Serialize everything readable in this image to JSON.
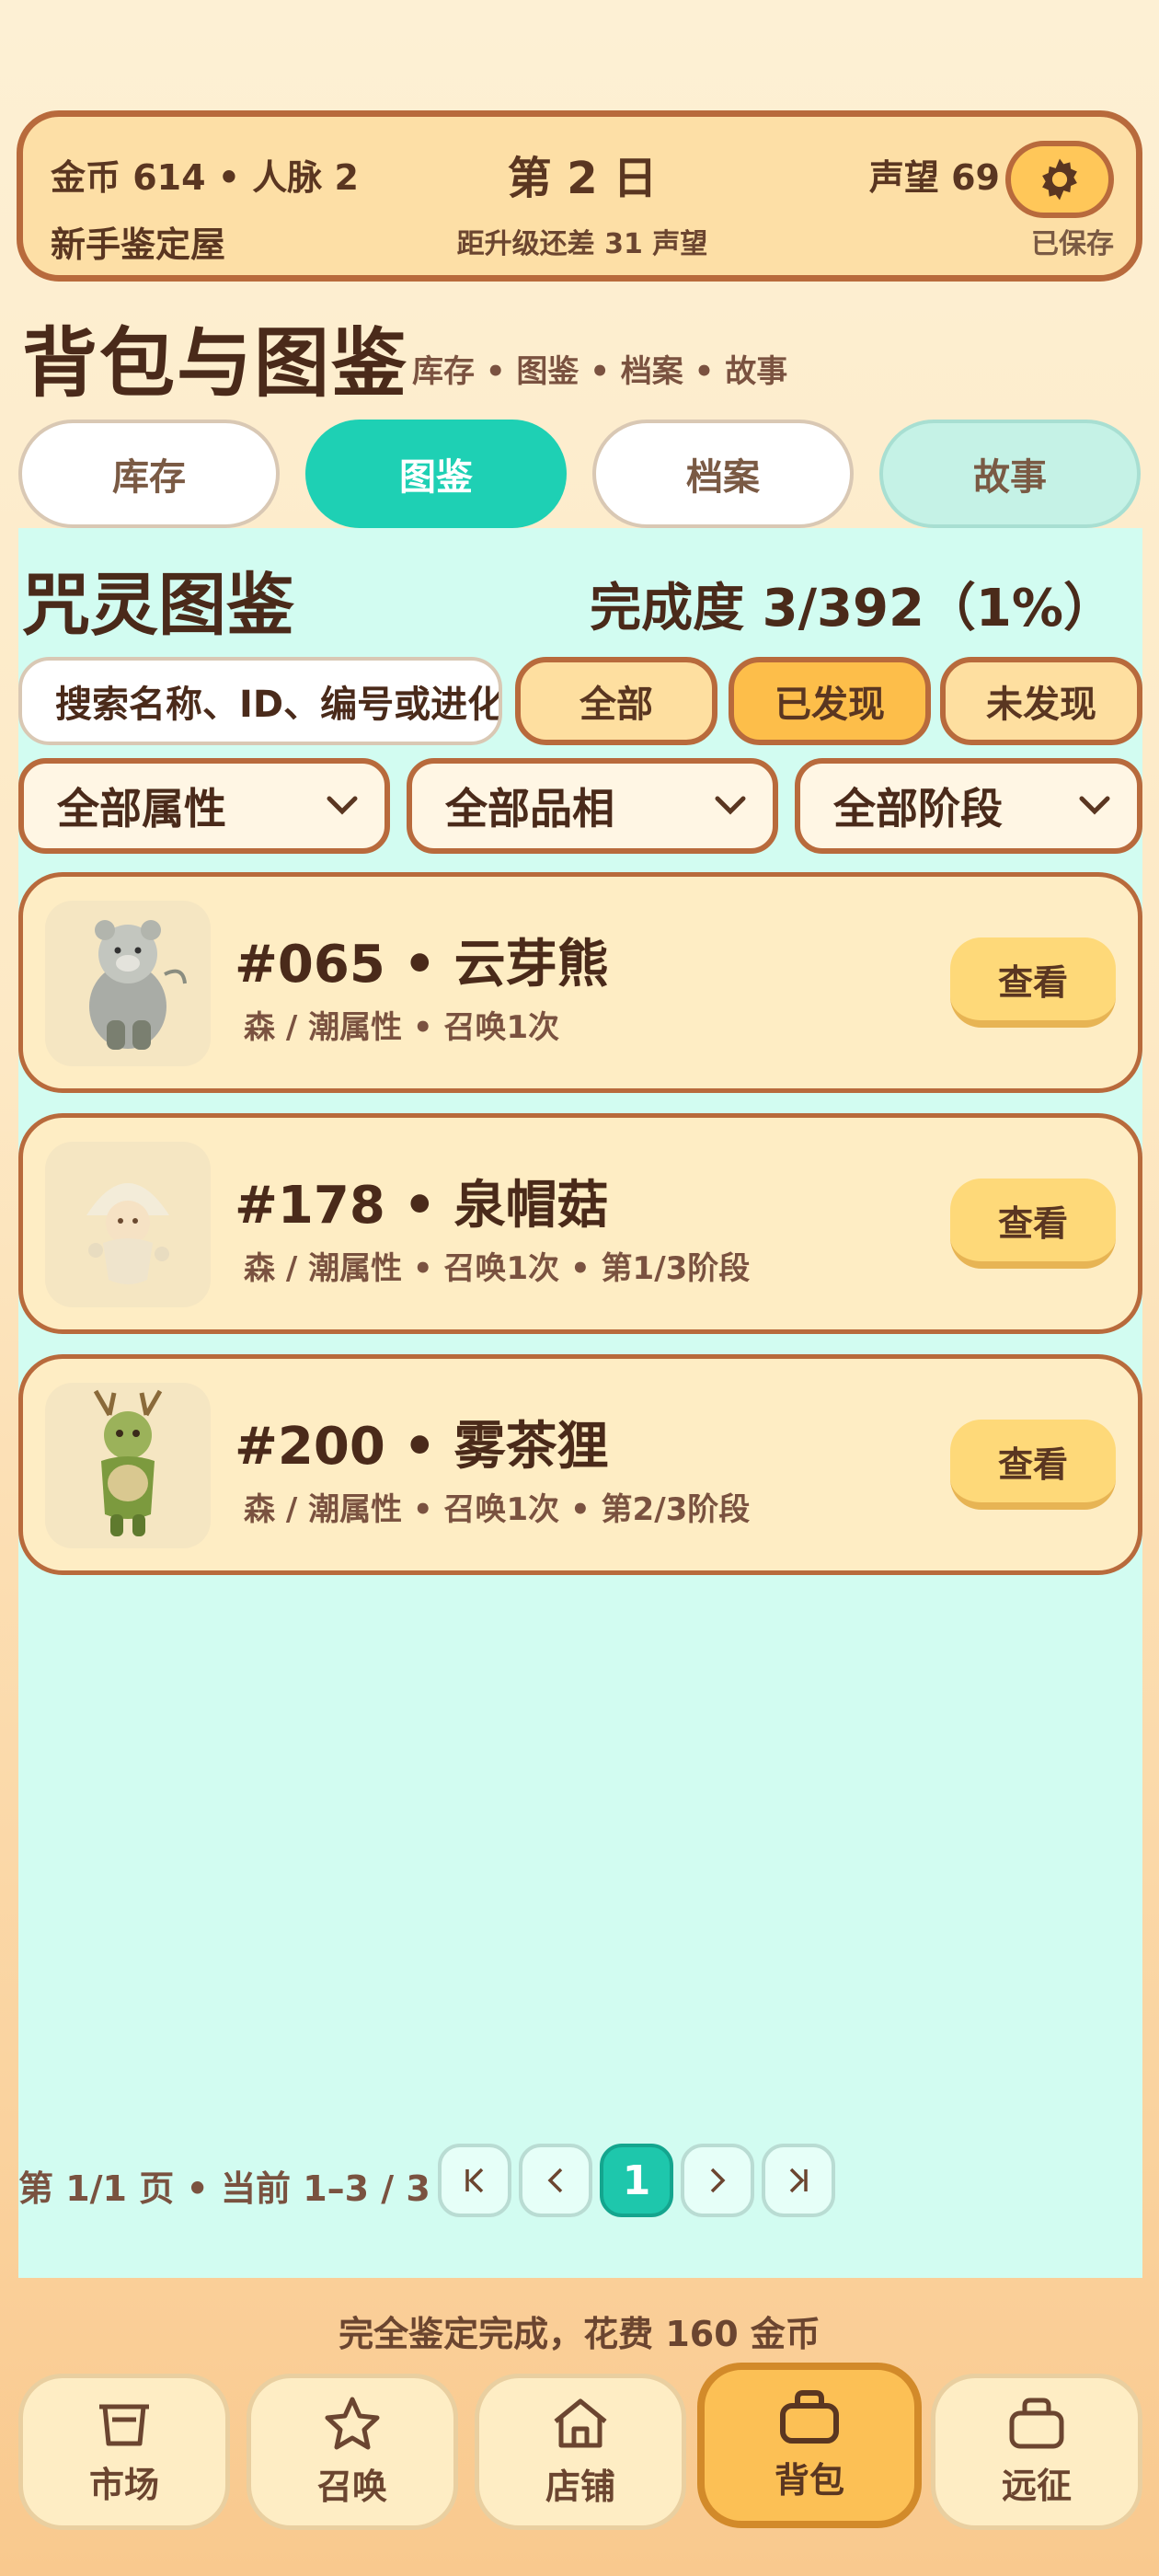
{
  "hud": {
    "money": "金币 614 • 人脉 2",
    "day": "第 2 日",
    "reputation": "声望 69",
    "settings_icon": "gear-icon",
    "shop_name": "新手鉴定屋",
    "upgrade_hint": "距升级还差 31 声望",
    "saved": "已保存"
  },
  "page": {
    "title": "背包与图鉴",
    "subtitle": "库存 • 图鉴 • 档案 • 故事"
  },
  "tabs": [
    {
      "label": "库存"
    },
    {
      "label": "图鉴"
    },
    {
      "label": "档案"
    },
    {
      "label": "故事"
    }
  ],
  "dex": {
    "title": "咒灵图鉴",
    "completion": "完成度 3/392（1%）",
    "search_placeholder": "搜索名称、ID、编号或进化",
    "filters": [
      "全部",
      "已发现",
      "未发现"
    ],
    "selects": [
      "全部属性",
      "全部品相",
      "全部阶段"
    ],
    "entries": [
      {
        "name": "#065 • 云芽熊",
        "meta": "森 / 潮属性 • 召唤1次",
        "action": "查看"
      },
      {
        "name": "#178 • 泉帽菇",
        "meta": "森 / 潮属性 • 召唤1次 • 第1/3阶段",
        "action": "查看"
      },
      {
        "name": "#200 • 雾茶狸",
        "meta": "森 / 潮属性 • 召唤1次 • 第2/3阶段",
        "action": "查看"
      }
    ],
    "pager": {
      "info": "第 1/1 页 • 当前 1–3 / 3",
      "current": "1"
    }
  },
  "toast": "完全鉴定完成，花费 160 金币",
  "nav": [
    {
      "label": "市场",
      "icon": "basket-icon"
    },
    {
      "label": "召唤",
      "icon": "star-icon"
    },
    {
      "label": "店铺",
      "icon": "house-icon"
    },
    {
      "label": "背包",
      "icon": "bag-icon"
    },
    {
      "label": "远征",
      "icon": "bag-icon"
    }
  ],
  "colors": {
    "accent": "#1ed0b4",
    "border": "#b86a3c",
    "panel": "#d2fcf1"
  }
}
